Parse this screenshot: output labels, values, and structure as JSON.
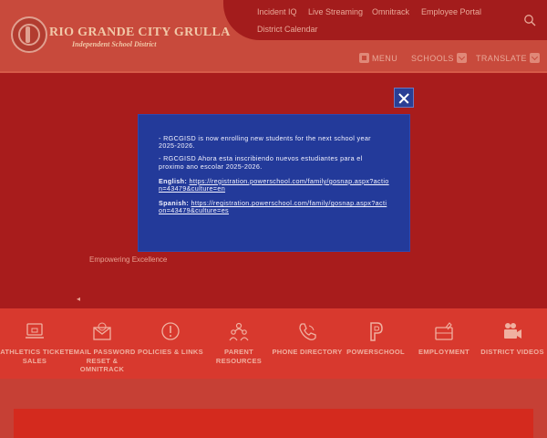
{
  "header": {
    "district_name": "RIO GRANDE CITY GRULLA",
    "district_subtitle": "Independent School District",
    "top_links": [
      "Incident IQ",
      "Live Streaming",
      "Omnitrack",
      "Employee Portal",
      "District Calendar"
    ],
    "menu_label": "MENU",
    "schools_label": "SCHOOLS",
    "translate_label": "TRANSLATE"
  },
  "hero": {
    "tagline": "Empowering Excellence",
    "indicator": "◂"
  },
  "quick_links": [
    {
      "label": "ATHLETICS TICKET SALES",
      "icon": "laptop-icon"
    },
    {
      "label": "EMAIL PASSWORD RESET & OMNITRACK",
      "icon": "envelope-icon"
    },
    {
      "label": "POLICIES & LINKS",
      "icon": "alert-icon"
    },
    {
      "label": "PARENT RESOURCES",
      "icon": "family-icon"
    },
    {
      "label": "PHONE DIRECTORY",
      "icon": "phone-icon"
    },
    {
      "label": "POWERSCHOOL",
      "icon": "powerschool-icon"
    },
    {
      "label": "EMPLOYMENT",
      "icon": "briefcase-icon"
    },
    {
      "label": "DISTRICT VIDEOS",
      "icon": "video-camera-icon"
    }
  ],
  "modal": {
    "line1": "- RGCGISD is now enrolling new students for the next school year 2025-2026.",
    "line2": "- RGCGISD Ahora esta inscribiendo nuevos estudiantes para el proximo ano escolar 2025-2026.",
    "english_label": "English:",
    "english_link": "https://registration.powerschool.com/family/gosnap.aspx?action=43479&culture=en",
    "spanish_label": "Spanish:",
    "spanish_link": "https://registration.powerschool.com/family/gosnap.aspx?action=43479&culture=es"
  },
  "colors": {
    "header_bg": "#c84a3c",
    "page_bg": "#a81c1c",
    "modal_bg": "#233a9a",
    "quick_band_bg": "#d8392e"
  }
}
